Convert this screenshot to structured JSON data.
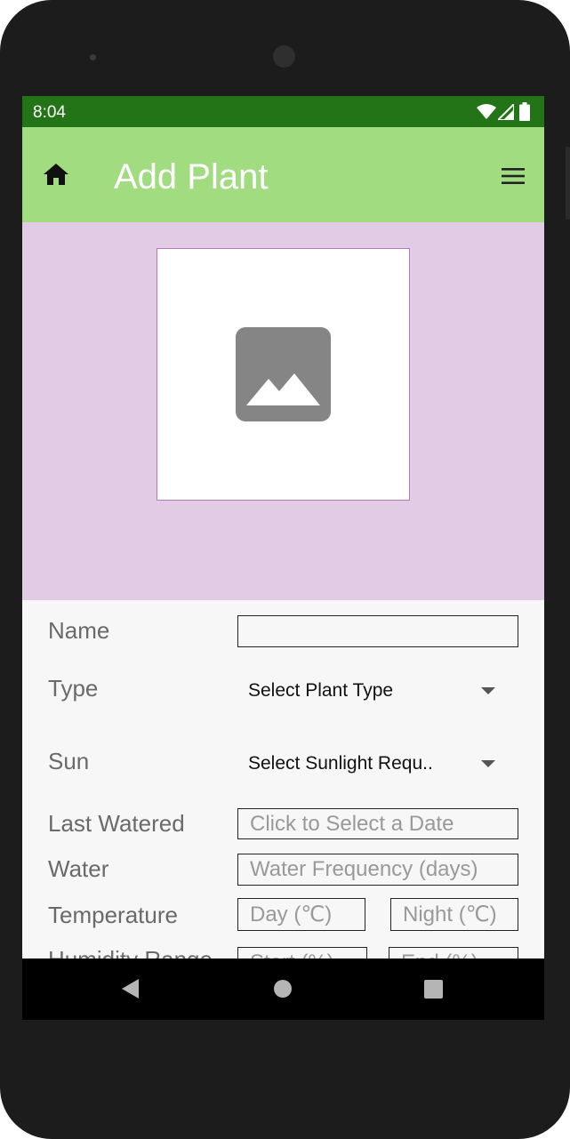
{
  "status_bar": {
    "time": "8:04",
    "icons": [
      "wifi-icon",
      "signal-icon",
      "battery-icon"
    ]
  },
  "app_bar": {
    "title": "Add Plant",
    "left_icon": "home-icon",
    "right_icon": "menu-icon"
  },
  "photo": {
    "icon": "image-placeholder-icon"
  },
  "form": {
    "name": {
      "label": "Name",
      "value": ""
    },
    "type": {
      "label": "Type",
      "selected": "Select Plant Type"
    },
    "sun": {
      "label": "Sun",
      "selected": "Select Sunlight Requ.."
    },
    "last_watered": {
      "label": "Last Watered",
      "placeholder": "Click to Select a Date"
    },
    "water": {
      "label": "Water",
      "placeholder": "Water Frequency (days)"
    },
    "temperature": {
      "label": "Temperature",
      "day_placeholder": "Day (℃)",
      "night_placeholder": "Night (℃)"
    },
    "humidity": {
      "label": "Humidity Range",
      "start_placeholder": "Start (%)",
      "end_placeholder": "End (%)"
    }
  },
  "nav_bar": {
    "icons": [
      "back-icon",
      "home-circle-icon",
      "recents-icon"
    ]
  },
  "colors": {
    "status_bar": "#237417",
    "app_bar": "#a2dc80",
    "hero_background": "#e1cbe5",
    "form_background": "#f7f7f7"
  }
}
